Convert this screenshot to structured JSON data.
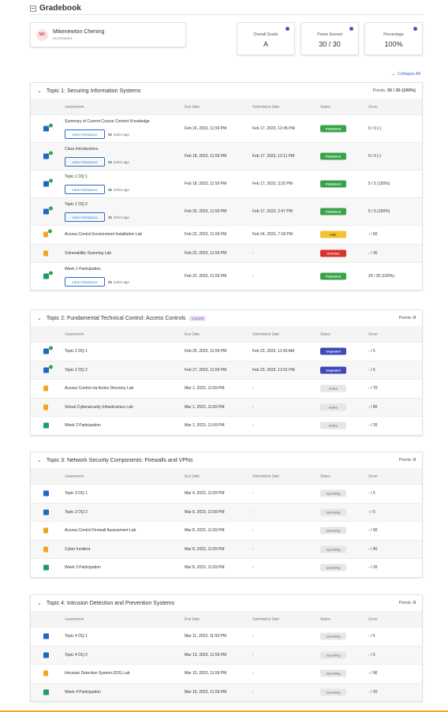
{
  "header": {
    "title": "Gradebook"
  },
  "student": {
    "initials": "MC",
    "name": "Mikenewton Chening",
    "id": "0123946661"
  },
  "stats": [
    {
      "label": "Overall Grade",
      "value": "A"
    },
    {
      "label": "Points Earned",
      "value": "30 / 30"
    },
    {
      "label": "Percentage",
      "value": "100%"
    }
  ],
  "collapse_all": "Collapse All",
  "columns": {
    "assessment": "Assessment",
    "due": "Due Date",
    "submission": "Submission Date",
    "status": "Status",
    "score": "Score"
  },
  "feedback_label": "VIEW FEEDBACK",
  "topics": [
    {
      "title": "Topic 1: Securing Information Systems",
      "badge": "",
      "points_label": "Points:",
      "points": "30 / 30 (100%)",
      "rows": [
        {
          "icon": "discussion-icon",
          "name": "Summary of Current Course Content Knowledge",
          "feedback": true,
          "ago": "21hrs ago",
          "due": "Feb 16, 2023, 11:59 PM",
          "sub": "Feb 17, 2023, 12:45 PM",
          "status": "Published",
          "score": "0 / 0 (-)",
          "done": true
        },
        {
          "icon": "discussion-icon",
          "name": "Class Introductions",
          "feedback": true,
          "ago": "21hrs ago",
          "due": "Feb 18, 2023, 11:59 PM",
          "sub": "Feb 17, 2023, 12:11 PM",
          "status": "Published",
          "score": "0 / 0 (-)",
          "done": true
        },
        {
          "icon": "discussion-icon",
          "name": "Topic 1 DQ 1",
          "feedback": true,
          "ago": "21hrs ago",
          "due": "Feb 18, 2023, 11:59 PM",
          "sub": "Feb 17, 2023, 3:20 PM",
          "status": "Published",
          "score": "5 / 5 (100%)",
          "done": true
        },
        {
          "icon": "discussion-icon",
          "name": "Topic 1 DQ 2",
          "feedback": true,
          "ago": "21hrs ago",
          "due": "Feb 20, 2023, 11:59 PM",
          "sub": "Feb 17, 2023, 2:47 PM",
          "status": "Published",
          "score": "5 / 5 (100%)",
          "done": true
        },
        {
          "icon": "file-icon",
          "name": "Access Control Environment Installation Lab",
          "feedback": false,
          "ago": "",
          "due": "Feb 22, 2023, 11:59 PM",
          "sub": "Feb 24, 2023, 7:18 PM",
          "status": "Late",
          "score": "- / 60",
          "done": true
        },
        {
          "icon": "file-icon",
          "name": "Vulnerability Scanning Lab",
          "feedback": false,
          "ago": "",
          "due": "Feb 22, 2023, 11:59 PM",
          "sub": "-",
          "status": "Overdue",
          "score": "- / 30",
          "done": false
        },
        {
          "icon": "participation-icon",
          "name": "Week 1 Participation",
          "feedback": true,
          "ago": "21hrs ago",
          "due": "Feb 22, 2023, 11:59 PM",
          "sub": "-",
          "status": "Published",
          "score": "20 / 20 (100%)",
          "done": true
        }
      ]
    },
    {
      "title": "Topic 2: Fundamental Technical Control: Access Controls",
      "badge": "Current",
      "points_label": "Points:",
      "points": "0",
      "rows": [
        {
          "icon": "discussion-icon",
          "name": "Topic 2 DQ 1",
          "feedback": false,
          "ago": "",
          "due": "Feb 25, 2023, 11:59 PM",
          "sub": "Feb 23, 2023, 11:43 AM",
          "status": "Ungraded",
          "score": "- / 5",
          "done": true
        },
        {
          "icon": "discussion-icon",
          "name": "Topic 2 DQ 2",
          "feedback": false,
          "ago": "",
          "due": "Feb 27, 2023, 11:59 PM",
          "sub": "Feb 23, 2023, 12:01 PM",
          "status": "Ungraded",
          "score": "- / 5",
          "done": true
        },
        {
          "icon": "file-icon",
          "name": "Access Control via Active Directory Lab",
          "feedback": false,
          "ago": "",
          "due": "Mar 1, 2023, 11:59 PM",
          "sub": "-",
          "status": "Active",
          "score": "- / 70",
          "done": false
        },
        {
          "icon": "file-icon",
          "name": "Virtual Cybersecurity Infrastructure Lab",
          "feedback": false,
          "ago": "",
          "due": "Mar 1, 2023, 11:59 PM",
          "sub": "-",
          "status": "Active",
          "score": "- / 80",
          "done": false
        },
        {
          "icon": "participation-icon",
          "name": "Week 2 Participation",
          "feedback": false,
          "ago": "",
          "due": "Mar 1, 2023, 11:59 PM",
          "sub": "-",
          "status": "Active",
          "score": "- / 20",
          "done": false
        }
      ]
    },
    {
      "title": "Topic 3: Network Security Components: Firewalls and VPNs",
      "badge": "",
      "points_label": "Points:",
      "points": "0",
      "rows": [
        {
          "icon": "discussion-icon",
          "name": "Topic 3 DQ 1",
          "feedback": false,
          "ago": "",
          "due": "Mar 4, 2023, 11:59 PM",
          "sub": "-",
          "status": "Upcoming",
          "score": "- / 5",
          "done": false
        },
        {
          "icon": "discussion-icon",
          "name": "Topic 3 DQ 2",
          "feedback": false,
          "ago": "",
          "due": "Mar 6, 2023, 11:59 PM",
          "sub": "-",
          "status": "Upcoming",
          "score": "- / 5",
          "done": false
        },
        {
          "icon": "file-icon",
          "name": "Access Control Firewall Assessment Lab",
          "feedback": false,
          "ago": "",
          "due": "Mar 8, 2023, 11:59 PM",
          "sub": "-",
          "status": "Upcoming",
          "score": "- / 90",
          "done": false
        },
        {
          "icon": "file-icon",
          "name": "Cyber Incident",
          "feedback": false,
          "ago": "",
          "due": "Mar 8, 2023, 11:59 PM",
          "sub": "-",
          "status": "Upcoming",
          "score": "- / 40",
          "done": false
        },
        {
          "icon": "participation-icon",
          "name": "Week 3 Participation",
          "feedback": false,
          "ago": "",
          "due": "Mar 8, 2023, 11:59 PM",
          "sub": "-",
          "status": "Upcoming",
          "score": "- / 20",
          "done": false
        }
      ]
    },
    {
      "title": "Topic 4: Intrusion Detection and Prevention Systems",
      "badge": "",
      "points_label": "Points:",
      "points": "0",
      "rows": [
        {
          "icon": "discussion-icon",
          "name": "Topic 4 DQ 1",
          "feedback": false,
          "ago": "",
          "due": "Mar 11, 2023, 11:59 PM",
          "sub": "-",
          "status": "Upcoming",
          "score": "- / 5",
          "done": false
        },
        {
          "icon": "discussion-icon",
          "name": "Topic 4 DQ 2",
          "feedback": false,
          "ago": "",
          "due": "Mar 13, 2023, 11:59 PM",
          "sub": "-",
          "status": "Upcoming",
          "score": "- / 5",
          "done": false
        },
        {
          "icon": "file-icon",
          "name": "Intrusion Detection System (IDS) Lab",
          "feedback": false,
          "ago": "",
          "due": "Mar 15, 2023, 11:59 PM",
          "sub": "-",
          "status": "Upcoming",
          "score": "- / 90",
          "done": false
        },
        {
          "icon": "participation-icon",
          "name": "Week 4 Participation",
          "feedback": false,
          "ago": "",
          "due": "Mar 15, 2023, 11:59 PM",
          "sub": "-",
          "status": "Upcoming",
          "score": "- / 20",
          "done": false
        }
      ]
    }
  ]
}
